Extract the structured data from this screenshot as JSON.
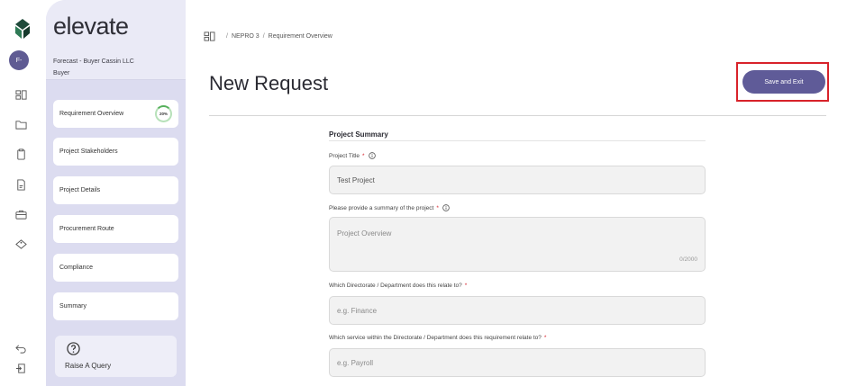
{
  "sidebar": {
    "avatar_initials": "F-",
    "brand": "elevate",
    "org_name": "Forecast - Buyer Cassin LLC",
    "org_role": "Buyer",
    "steps": [
      {
        "label": "Requirement Overview",
        "progress": "20%"
      },
      {
        "label": "Project Stakeholders"
      },
      {
        "label": "Project Details"
      },
      {
        "label": "Procurement Route"
      },
      {
        "label": "Compliance"
      },
      {
        "label": "Summary"
      }
    ],
    "query_label": "Raise A Query"
  },
  "breadcrumb": {
    "items": [
      "NEPRO 3",
      "Requirement Overview"
    ]
  },
  "header": {
    "title": "New Request",
    "save_label": "Save and Exit"
  },
  "form": {
    "section_title": "Project Summary",
    "project_title_label": "Project Title",
    "project_title_value": "Test Project",
    "summary_label": "Please provide a summary of the project",
    "summary_placeholder": "Project Overview",
    "summary_count": "0/2000",
    "directorate_label": "Which Directorate / Department does this relate to?",
    "directorate_placeholder": "e.g. Finance",
    "service_label": "Which service within the Directorate / Department does this requirement relate to?",
    "service_placeholder": "e.g. Payroll",
    "required_marker": "*"
  },
  "colors": {
    "accent": "#5f5b98",
    "panel": "#dcdcf0",
    "highlight": "#d8222a",
    "required": "#d6242c"
  }
}
